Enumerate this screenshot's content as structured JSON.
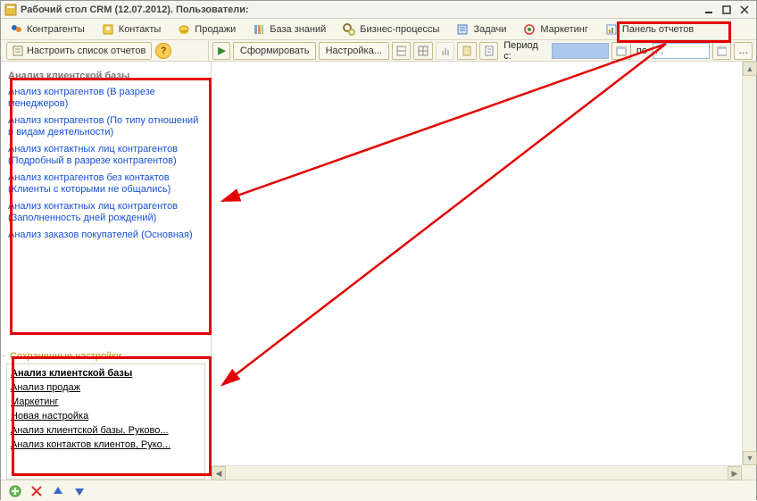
{
  "window": {
    "title": "Рабочий стол CRM (12.07.2012). Пользователи:"
  },
  "nav": {
    "items": [
      {
        "label": "Контрагенты",
        "icon": "people-icon"
      },
      {
        "label": "Контакты",
        "icon": "contacts-icon"
      },
      {
        "label": "Продажи",
        "icon": "coins-icon"
      },
      {
        "label": "База знаний",
        "icon": "books-icon"
      },
      {
        "label": "Бизнес-процессы",
        "icon": "gears-icon"
      },
      {
        "label": "Задачи",
        "icon": "tasks-icon"
      },
      {
        "label": "Маркетинг",
        "icon": "target-icon"
      },
      {
        "label": "Панель отчетов",
        "icon": "reports-icon"
      }
    ]
  },
  "left_toolbar": {
    "configure_label": "Настроить список отчетов"
  },
  "right_toolbar": {
    "form_label": "Сформировать",
    "settings_label": "Настройка...",
    "period_label": "Период с:",
    "period_to": "по",
    "period_from_value": "",
    "period_to_value": ". .",
    "period_to_placeholder": ". ."
  },
  "reports": {
    "section_title": "Анализ клиентской базы",
    "links": [
      "Анализ контрагентов (В разрезе менеджеров)",
      "Анализ контрагентов (По типу отношений и видам деятельности)",
      "Анализ контактных лиц контрагентов (Подробный в разрезе контрагентов)",
      "Анализ контрагентов без контактов (Клиенты с которыми не общались)",
      "Анализ контактных лиц контрагентов (Заполненность дней рождений)",
      "Анализ заказов покупателей (Основная)"
    ]
  },
  "saved": {
    "legend": "Сохраненные настройки",
    "items": [
      {
        "label": "Анализ клиентской базы",
        "bold": true
      },
      {
        "label": "Анализ продаж"
      },
      {
        "label": "Маркетинг"
      },
      {
        "label": "Новая настройка"
      },
      {
        "label": "Анализ клиентской базы, Руково..."
      },
      {
        "label": "Анализ контактов клиентов, Руко..."
      }
    ]
  }
}
